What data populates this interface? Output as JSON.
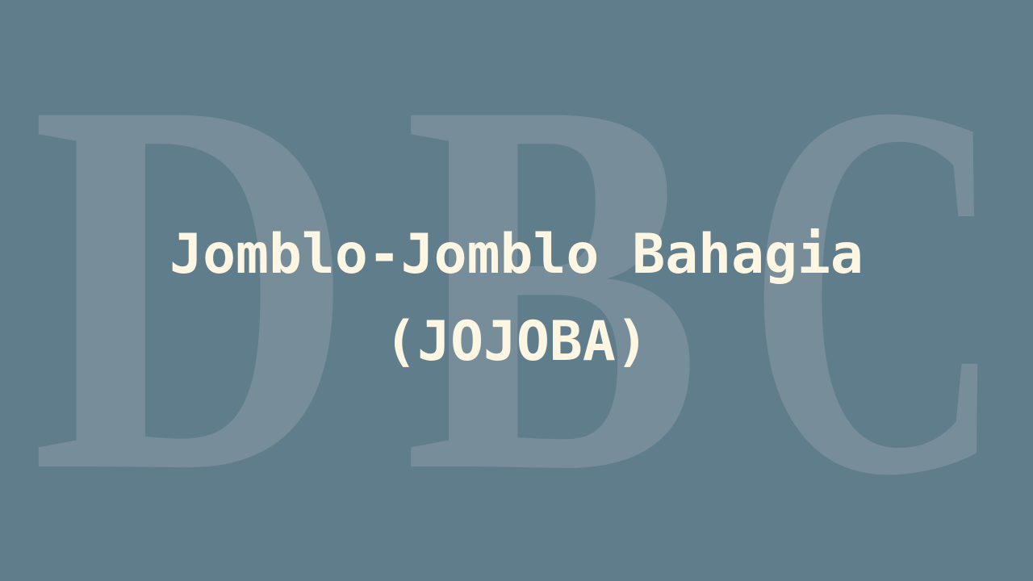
{
  "watermark": {
    "letters": [
      "D",
      "B",
      "C"
    ]
  },
  "title": {
    "line1": "Jomblo-Jomblo Bahagia",
    "line2": "(JOJOBA)"
  },
  "colors": {
    "background": "#607d8b",
    "watermark": "#778d9a",
    "title": "#fdf6e3"
  }
}
